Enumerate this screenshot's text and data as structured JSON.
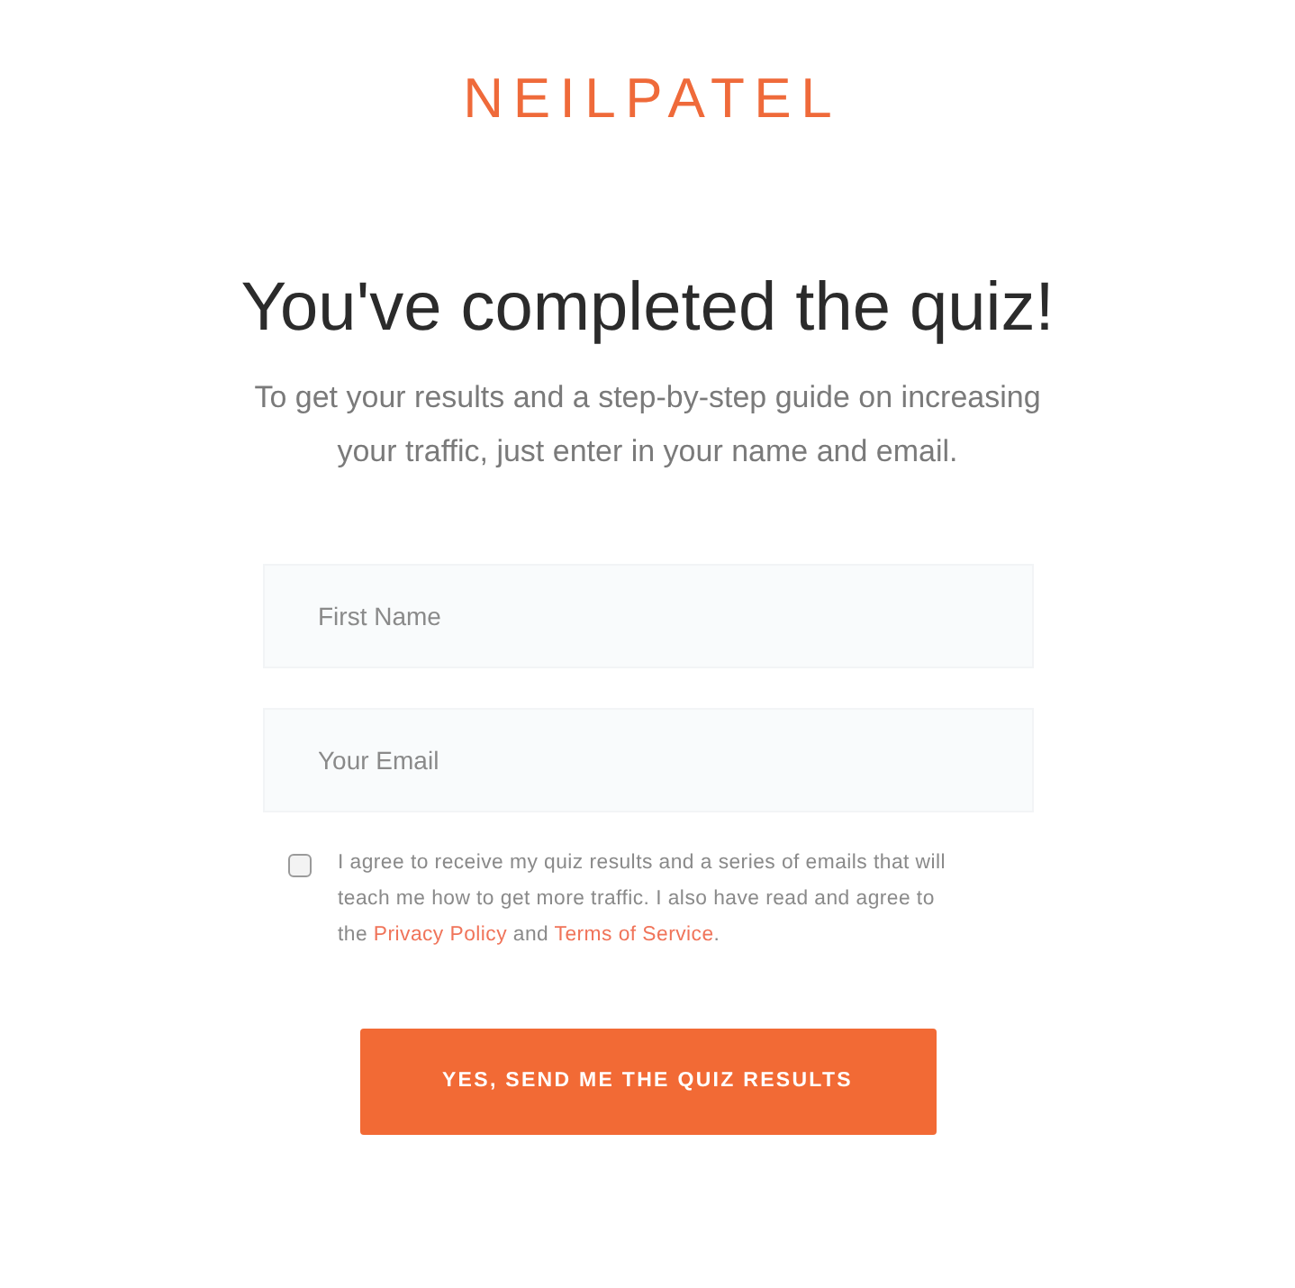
{
  "logo": {
    "text": "NEILPATEL"
  },
  "heading": "You've completed the quiz!",
  "intro": "To get your results and a step-by-step guide on increasing your traffic, just enter in your name and email.",
  "fields": [
    {
      "placeholder": "First Name"
    },
    {
      "placeholder": "Your Email"
    }
  ],
  "consent": {
    "checked": false,
    "parts": [
      {
        "kind": "text",
        "text": "I agree to receive my quiz results and a series of emails that will teach me how to get more traffic. I also have read and agree to the "
      },
      {
        "kind": "link",
        "text": "Privacy Policy"
      },
      {
        "kind": "text",
        "text": " and "
      },
      {
        "kind": "link",
        "text": "Terms of Service"
      },
      {
        "kind": "text",
        "text": "."
      }
    ]
  },
  "submit_button": "YES, SEND ME THE QUIZ RESULTS"
}
